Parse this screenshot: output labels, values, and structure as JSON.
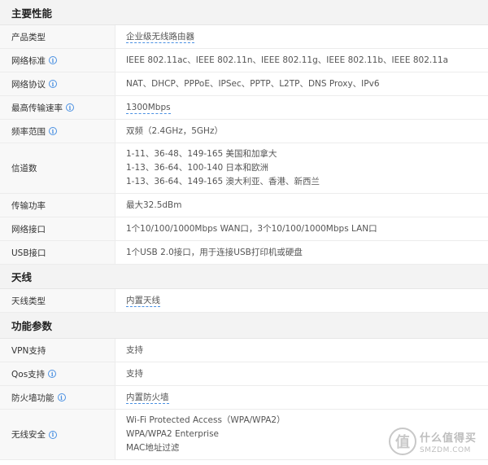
{
  "sections": [
    {
      "title": "主要性能",
      "rows": [
        {
          "label": "产品类型",
          "values": [
            "企业级无线路由器"
          ],
          "info": false,
          "dashed": true
        },
        {
          "label": "网络标准",
          "values": [
            "IEEE 802.11ac、IEEE 802.11n、IEEE 802.11g、IEEE 802.11b、IEEE 802.11a"
          ],
          "info": true,
          "dashed": false
        },
        {
          "label": "网络协议",
          "values": [
            "NAT、DHCP、PPPoE、IPSec、PPTP、L2TP、DNS Proxy、IPv6"
          ],
          "info": true,
          "dashed": false
        },
        {
          "label": "最高传输速率",
          "values": [
            "1300Mbps"
          ],
          "info": true,
          "dashed": true
        },
        {
          "label": "频率范围",
          "values": [
            "双频（2.4GHz，5GHz）"
          ],
          "info": true,
          "dashed": false
        },
        {
          "label": "信道数",
          "values": [
            "1-11、36-48、149-165 美国和加拿大",
            "1-13、36-64、100-140 日本和欧洲",
            "1-13、36-64、149-165 澳大利亚、香港、新西兰"
          ],
          "info": false,
          "dashed": false
        },
        {
          "label": "传输功率",
          "values": [
            "最大32.5dBm"
          ],
          "info": false,
          "dashed": false
        },
        {
          "label": "网络接口",
          "values": [
            "1个10/100/1000Mbps WAN口，3个10/100/1000Mbps LAN口"
          ],
          "info": false,
          "dashed": false
        },
        {
          "label": "USB接口",
          "values": [
            "1个USB 2.0接口，用于连接USB打印机或硬盘"
          ],
          "info": false,
          "dashed": false
        }
      ]
    },
    {
      "title": "天线",
      "rows": [
        {
          "label": "天线类型",
          "values": [
            "内置天线"
          ],
          "info": false,
          "dashed": true
        }
      ]
    },
    {
      "title": "功能参数",
      "rows": [
        {
          "label": "VPN支持",
          "values": [
            "支持"
          ],
          "info": false,
          "dashed": false
        },
        {
          "label": "Qos支持",
          "values": [
            "支持"
          ],
          "info": true,
          "dashed": false
        },
        {
          "label": "防火墙功能",
          "values": [
            "内置防火墙"
          ],
          "info": true,
          "dashed": true
        },
        {
          "label": "无线安全",
          "values": [
            "Wi-Fi Protected Access（WPA/WPA2）",
            "WPA/WPA2 Enterprise",
            "MAC地址过滤"
          ],
          "info": true,
          "dashed": false
        }
      ]
    }
  ],
  "info_glyph": "i",
  "watermark": {
    "badge": "值",
    "cn": "什么值得买",
    "en": "SMZDM.COM"
  }
}
